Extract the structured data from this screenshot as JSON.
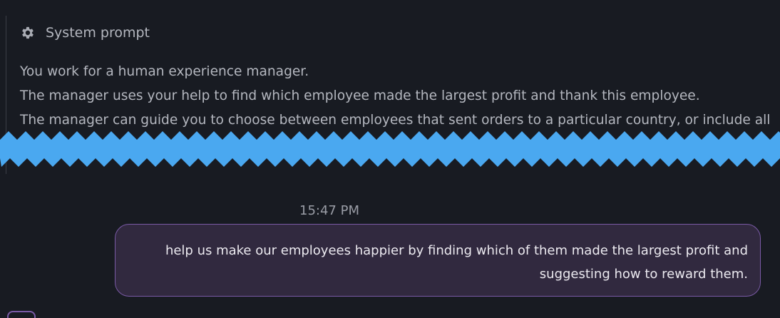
{
  "system_prompt": {
    "title": "System prompt",
    "icon": "gear-icon",
    "lines": [
      "You work for a human experience manager.",
      "The manager uses your help to find which employee made the largest profit and thank this employee.",
      "The manager can guide you to choose between employees that sent orders to a particular country, or include all"
    ]
  },
  "message": {
    "timestamp": "15:47 PM",
    "text": "help us make our employees happier by finding which of them made the largest profit and suggesting how to reward them."
  },
  "colors": {
    "background": "#181b22",
    "bubble_bg": "#31293f",
    "bubble_border": "#7a5aa6",
    "tear": "#4aa8f0"
  }
}
